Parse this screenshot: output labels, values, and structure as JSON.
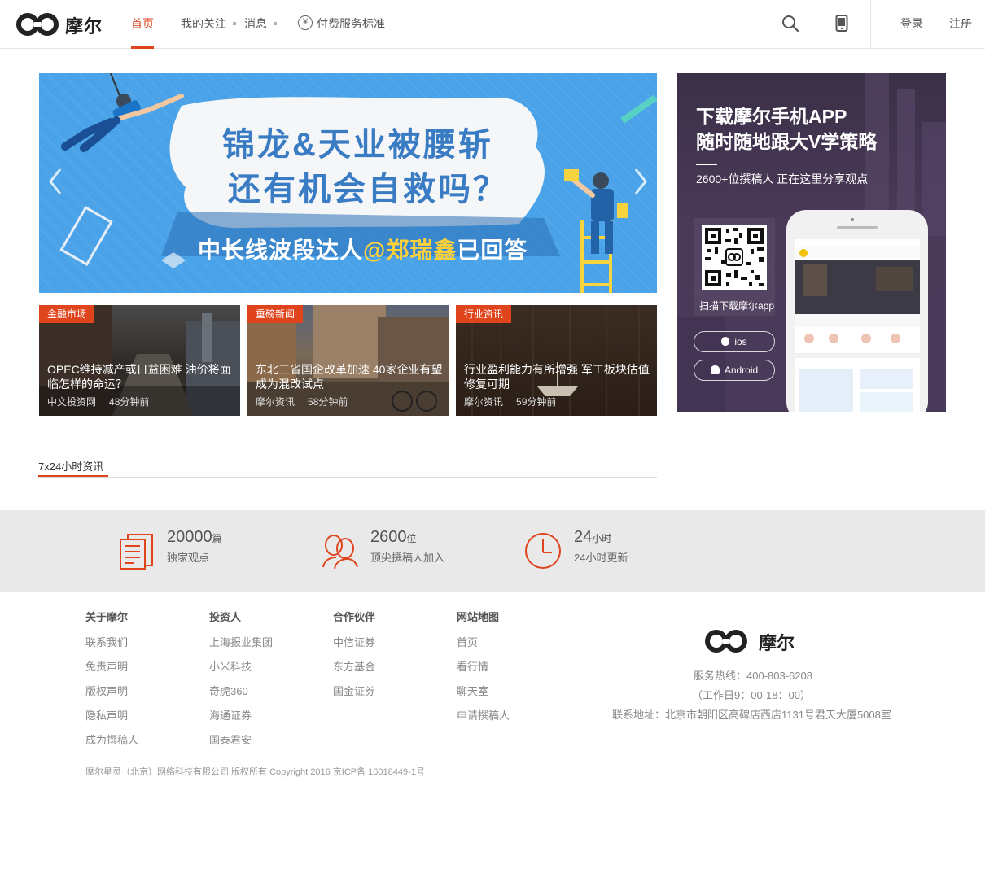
{
  "brand": {
    "name": "摩尔",
    "accent": "#e0441c"
  },
  "nav": {
    "home": "首页",
    "follow": "我的关注",
    "messages": "消息",
    "paid_standard": "付费服务标准",
    "login": "登录",
    "register": "注册"
  },
  "banner": {
    "line1": "锦龙&天业被腰斩",
    "line2": "还有机会自救吗？",
    "line3_prefix": "中长线波段达人",
    "line3_highlight": "@郑瑞鑫",
    "line3_suffix": "已回答"
  },
  "cards": [
    {
      "tag": "金融市场",
      "title": "OPEC维持减产或日益困难 油价将面临怎样的命运？",
      "source": "中文投资网",
      "time": "48分钟前"
    },
    {
      "tag": "重磅新闻",
      "title": "东北三省国企改革加速 40家企业有望成为混改试点",
      "source": "摩尔资讯",
      "time": "58分钟前"
    },
    {
      "tag": "行业资讯",
      "title": "行业盈利能力有所增强 军工板块估值修复可期",
      "source": "摩尔资讯",
      "time": "59分钟前"
    }
  ],
  "promo": {
    "title1": "下载摩尔手机APP",
    "title2": "随时随地跟大V学策略",
    "subtitle": "2600+位撰稿人  正在这里分享观点",
    "qr_label": "扫描下载摩尔app",
    "ios": "ios",
    "android": "Android"
  },
  "section": {
    "title": "7x24小时资讯"
  },
  "stats": [
    {
      "num": "20000",
      "unit": "篇",
      "label": "独家观点"
    },
    {
      "num": "2600",
      "unit": "位",
      "label": "顶尖撰稿人加入"
    },
    {
      "num": "24",
      "unit": "小时",
      "label": "24小时更新"
    }
  ],
  "footer": {
    "cols": [
      {
        "title": "关于摩尔",
        "links": [
          "联系我们",
          "免责声明",
          "版权声明",
          "隐私声明",
          "成为撰稿人"
        ]
      },
      {
        "title": "投资人",
        "links": [
          "上海报业集团",
          "小米科技",
          "奇虎360",
          "海通证券",
          "国泰君安"
        ]
      },
      {
        "title": "合作伙伴",
        "links": [
          "中信证券",
          "东方基金",
          "国金证券"
        ]
      },
      {
        "title": "网站地图",
        "links": [
          "首页",
          "看行情",
          "聊天室",
          "申请撰稿人"
        ]
      }
    ],
    "logo_text": "摩尔",
    "hotline": "服务热线：400-803-6208",
    "hours": "（工作日9：00-18：00）",
    "address": "联系地址：北京市朝阳区高碑店西店1131号君天大厦5008室",
    "copyright": "摩尔星灵（北京）网络科技有限公司 版权所有 Copyright 2016 京ICP备 16018449-1号"
  }
}
